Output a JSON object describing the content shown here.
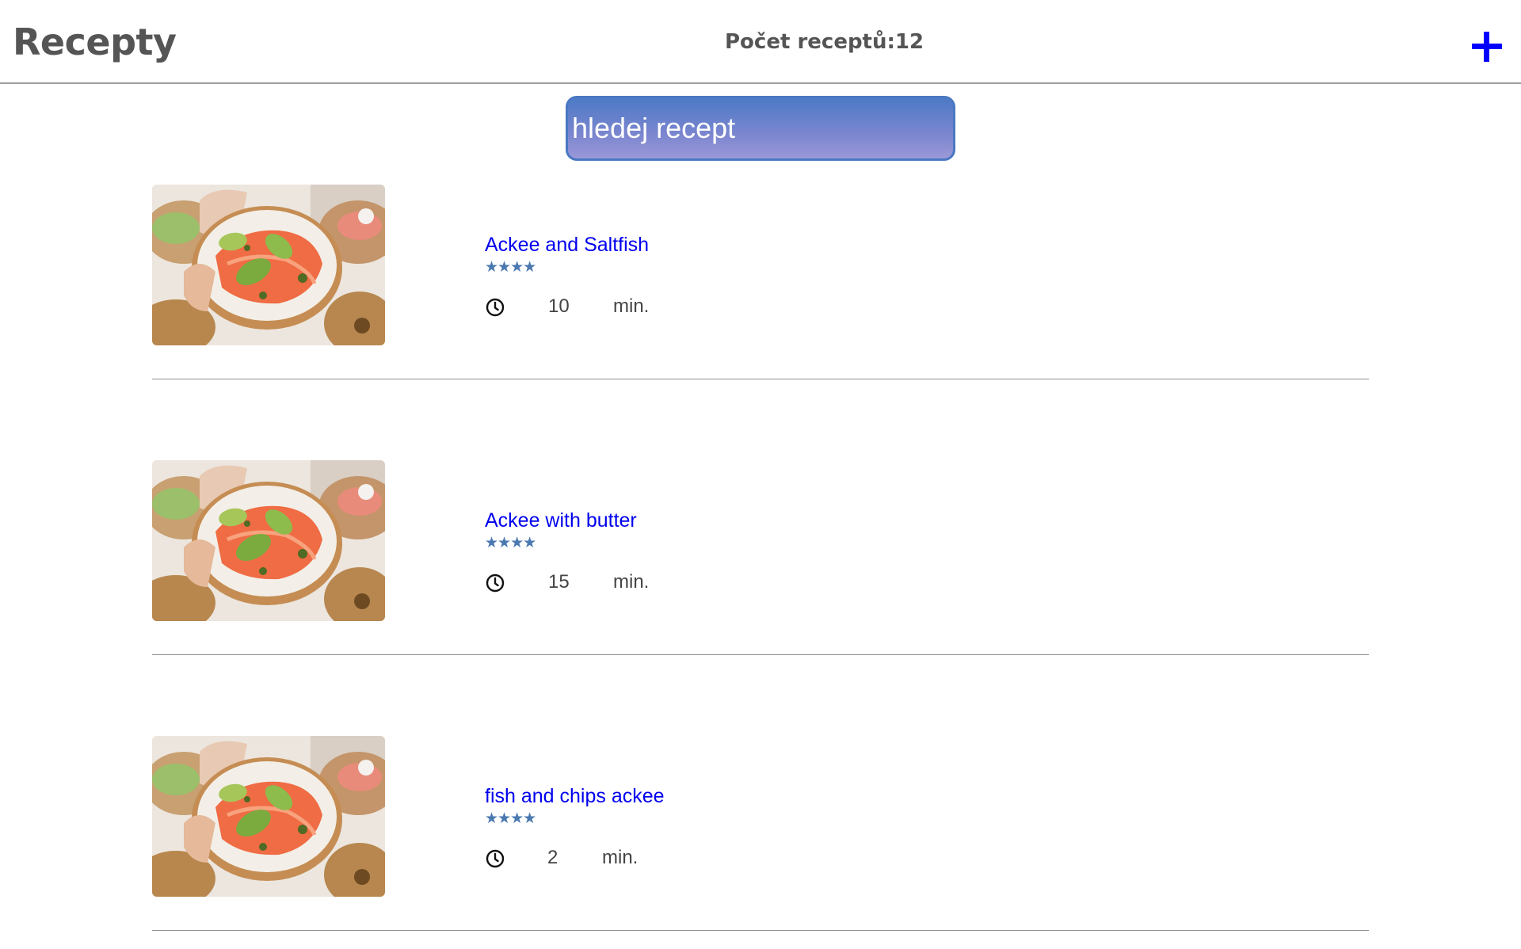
{
  "header": {
    "title": "Recepty",
    "count_text": "Počet receptů:12",
    "add_icon": "plus-icon"
  },
  "search": {
    "placeholder": "hledej recept",
    "value": ""
  },
  "colors": {
    "link": "#0000ee",
    "title": "#555555",
    "add": "#0000ff",
    "star": "#4a78b0",
    "search_border": "#4a78c2"
  },
  "recipes": [
    {
      "name": "Ackee and Saltfish",
      "stars": 4,
      "rating_glyphs": "★★★★",
      "time": "10",
      "unit": "min.",
      "icon": "clock-icon"
    },
    {
      "name": "Ackee with butter",
      "stars": 4,
      "rating_glyphs": "★★★★",
      "time": "15",
      "unit": "min.",
      "icon": "clock-icon"
    },
    {
      "name": "fish and chips ackee",
      "stars": 4,
      "rating_glyphs": "★★★★",
      "time": "2",
      "unit": "min.",
      "icon": "clock-icon"
    }
  ]
}
